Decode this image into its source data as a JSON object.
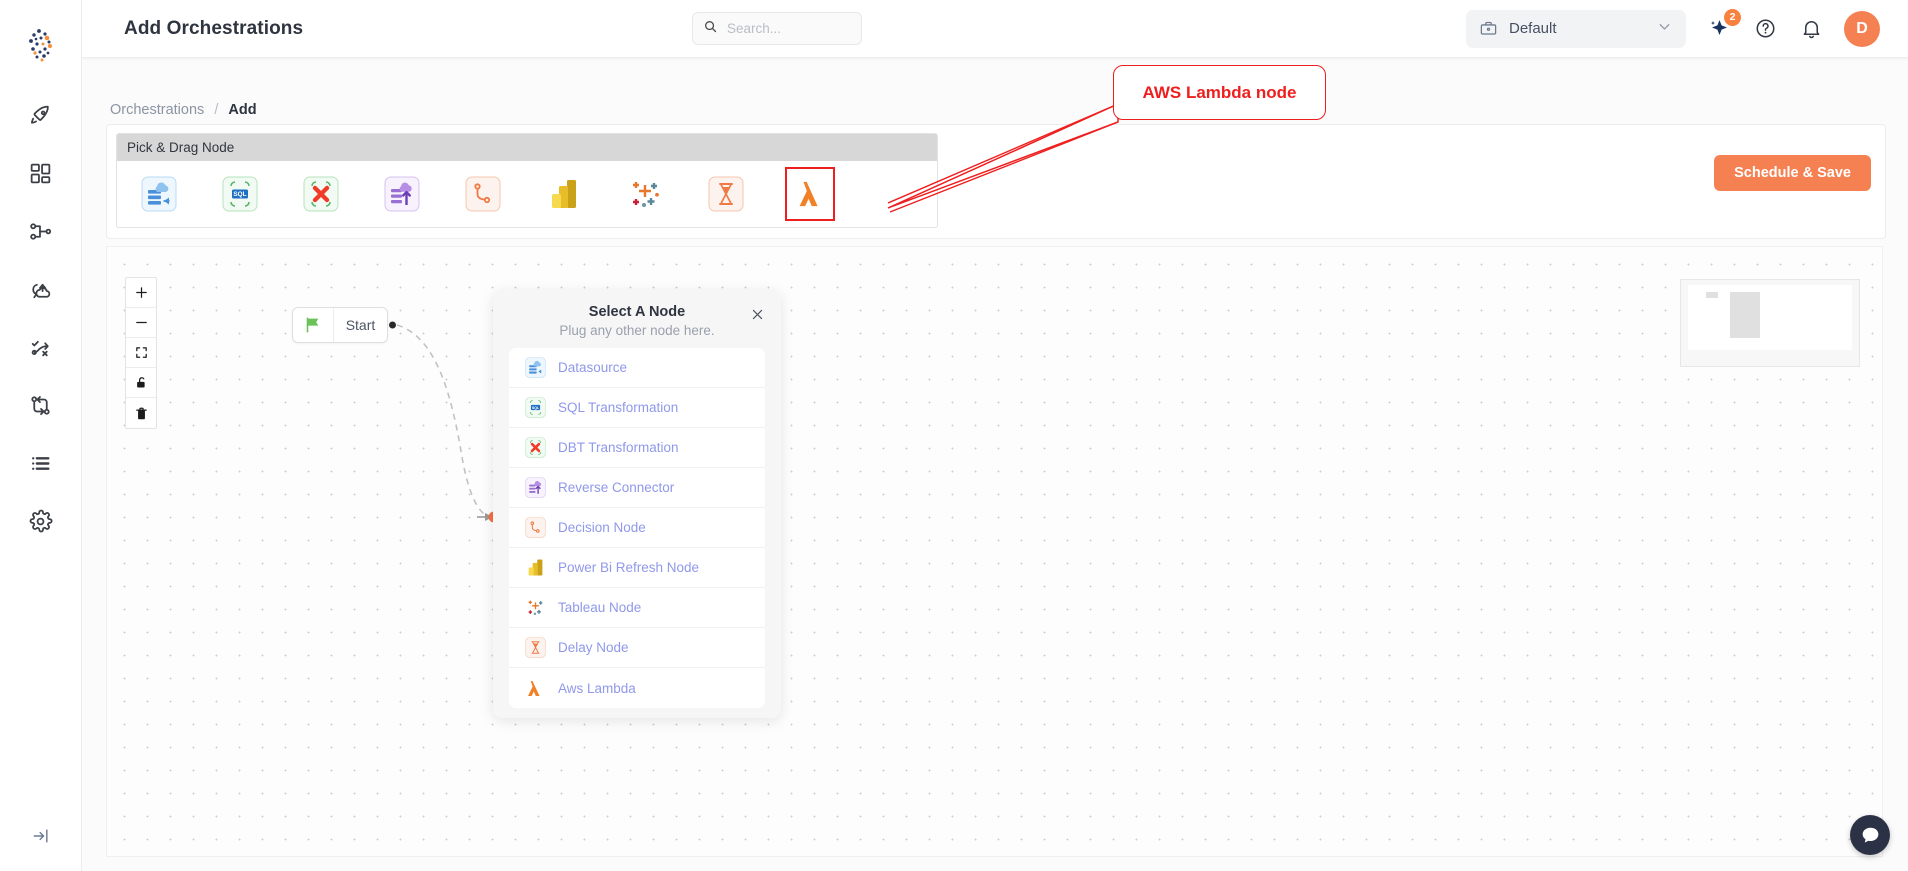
{
  "app": {
    "page_title": "Add Orchestrations",
    "logo_icon": "company-logo-icon"
  },
  "search": {
    "placeholder": "Search...",
    "value": "",
    "icon": "search-icon"
  },
  "topbar": {
    "workspace": {
      "label": "Default",
      "icon": "briefcase-icon",
      "chevron": "chevron-down-icon"
    },
    "ai_icon": "sparkle-icon",
    "ai_badge": "2",
    "help_icon": "help-circle-icon",
    "notification_icon": "bell-icon",
    "avatar_initial": "D",
    "avatar_color": "#f58153"
  },
  "sidebar": {
    "items": [
      {
        "icon": "rocket-icon",
        "name": "launch"
      },
      {
        "icon": "dashboard-grid-icon",
        "name": "dashboard"
      },
      {
        "icon": "pipeline-icon",
        "name": "pipelines"
      },
      {
        "icon": "sync-cloud-icon",
        "name": "sync"
      },
      {
        "icon": "workflow-route-icon",
        "name": "workflows"
      },
      {
        "icon": "branch-icon",
        "name": "branches"
      },
      {
        "icon": "list-icon",
        "name": "logs"
      },
      {
        "icon": "gear-icon",
        "name": "settings"
      }
    ],
    "collapse_icon": "collapse-panel-icon"
  },
  "breadcrumb": {
    "root": "Orchestrations",
    "separator": "/",
    "current": "Add"
  },
  "palette": {
    "title": "Pick & Drag Node",
    "nodes": [
      {
        "label": "Datasource",
        "icon": "datasource-icon",
        "highlighted": false
      },
      {
        "label": "SQL Transformation",
        "icon": "sql-transformation-icon",
        "highlighted": false
      },
      {
        "label": "DBT Transformation",
        "icon": "dbt-transformation-icon",
        "highlighted": false
      },
      {
        "label": "Reverse Connector",
        "icon": "reverse-connector-icon",
        "highlighted": false
      },
      {
        "label": "Decision Node",
        "icon": "decision-node-icon",
        "highlighted": false
      },
      {
        "label": "Power Bi Refresh Node",
        "icon": "power-bi-icon",
        "highlighted": false
      },
      {
        "label": "Tableau Node",
        "icon": "tableau-icon",
        "highlighted": false
      },
      {
        "label": "Delay Node",
        "icon": "delay-node-icon",
        "highlighted": false
      },
      {
        "label": "Aws Lambda",
        "icon": "aws-lambda-icon",
        "highlighted": true
      }
    ]
  },
  "actions": {
    "schedule_save": "Schedule & Save",
    "schedule_save_color": "#f58153"
  },
  "canvas": {
    "controls": [
      {
        "name": "zoom-in",
        "icon": "plus-icon"
      },
      {
        "name": "zoom-out",
        "icon": "minus-icon"
      },
      {
        "name": "fit-view",
        "icon": "fit-screen-icon"
      },
      {
        "name": "lock-canvas",
        "icon": "unlock-icon"
      },
      {
        "name": "delete-node",
        "icon": "trash-icon"
      }
    ],
    "start_node": {
      "label": "Start",
      "icon": "green-flag-icon"
    },
    "minimap": "minimap"
  },
  "select_node_popup": {
    "title": "Select A Node",
    "subtitle": "Plug any other node here.",
    "close_icon": "close-icon",
    "items": [
      {
        "label": "Datasource",
        "icon": "datasource-icon"
      },
      {
        "label": "SQL Transformation",
        "icon": "sql-transformation-icon"
      },
      {
        "label": "DBT Transformation",
        "icon": "dbt-transformation-icon"
      },
      {
        "label": "Reverse Connector",
        "icon": "reverse-connector-icon"
      },
      {
        "label": "Decision Node",
        "icon": "decision-node-icon"
      },
      {
        "label": "Power Bi Refresh Node",
        "icon": "power-bi-icon"
      },
      {
        "label": "Tableau Node",
        "icon": "tableau-icon"
      },
      {
        "label": "Delay Node",
        "icon": "delay-node-icon"
      },
      {
        "label": "Aws Lambda",
        "icon": "aws-lambda-icon"
      }
    ]
  },
  "annotation": {
    "text": "AWS Lambda node",
    "color": "#ee1f1f"
  },
  "chat": {
    "icon": "chat-bubble-icon"
  }
}
